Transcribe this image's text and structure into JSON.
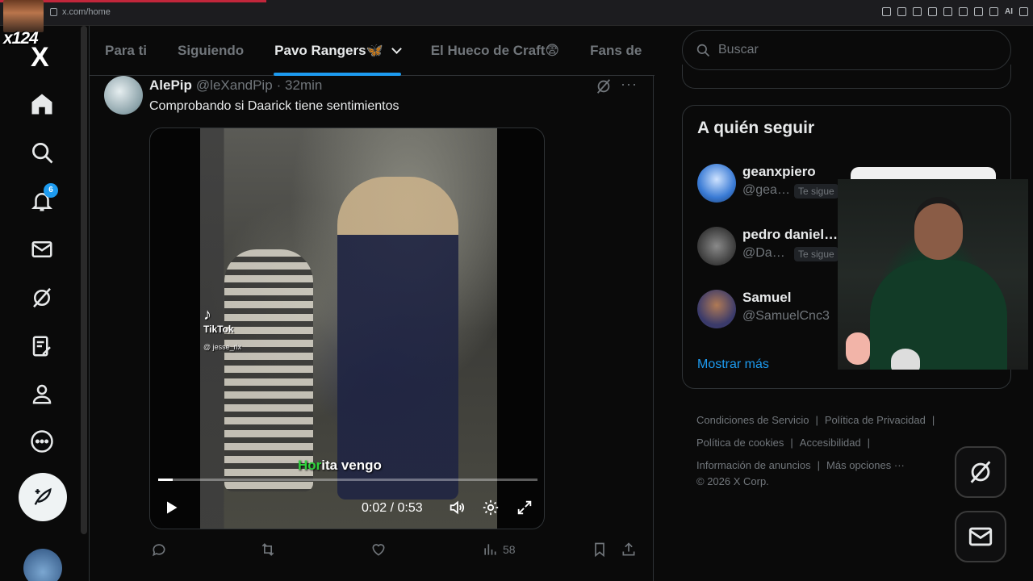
{
  "browser": {
    "url": "x.com/home",
    "ai_label": "AI"
  },
  "streamer": {
    "tag": "x124"
  },
  "nav": {
    "logo": "X",
    "notification_count": "6"
  },
  "tabs": [
    {
      "label": "Para ti"
    },
    {
      "label": "Siguiendo"
    },
    {
      "label": "Pavo Rangers🦋"
    },
    {
      "label": "El Hueco de Craft😨"
    },
    {
      "label": "Fans de"
    }
  ],
  "tweet": {
    "name": "AlePip",
    "handle": "@leXandPip",
    "time": "· 32min",
    "text": "Comprobando si Daarick tiene sentimientos",
    "video": {
      "watermark": "TikTok",
      "watermark_handle": "@ jesse_rix",
      "subtitle_highlight": "Hor",
      "subtitle_rest": "ita vengo",
      "time": "0:02 / 0:53",
      "progress": 0.038
    },
    "views": "58"
  },
  "search": {
    "placeholder": "Buscar"
  },
  "follow": {
    "title": "A quién seguir",
    "items": [
      {
        "name": "geanxpiero",
        "handle": "@gea…",
        "badge": "Te sigue",
        "color": "#3a7bd5"
      },
      {
        "name": "pedro daniel…",
        "handle": "@Da…",
        "badge": "Te sigue",
        "color": "#5a5a5a"
      },
      {
        "name": "Samuel",
        "handle": "@SamuelCnc3",
        "badge": "",
        "color": "#3a3a6a"
      }
    ],
    "show_more": "Mostrar más"
  },
  "footer": {
    "links_row1": [
      "Condiciones de Servicio",
      "Política de Privacidad"
    ],
    "links_row2": [
      "Política de cookies",
      "Accesibilidad"
    ],
    "links_row3": [
      "Información de anuncios",
      "Más opciones ···"
    ],
    "copyright": "© 2026 X Corp."
  },
  "colors": {
    "accent": "#1d9bf0",
    "background": "#0a0a0a",
    "muted": "#71767b"
  }
}
